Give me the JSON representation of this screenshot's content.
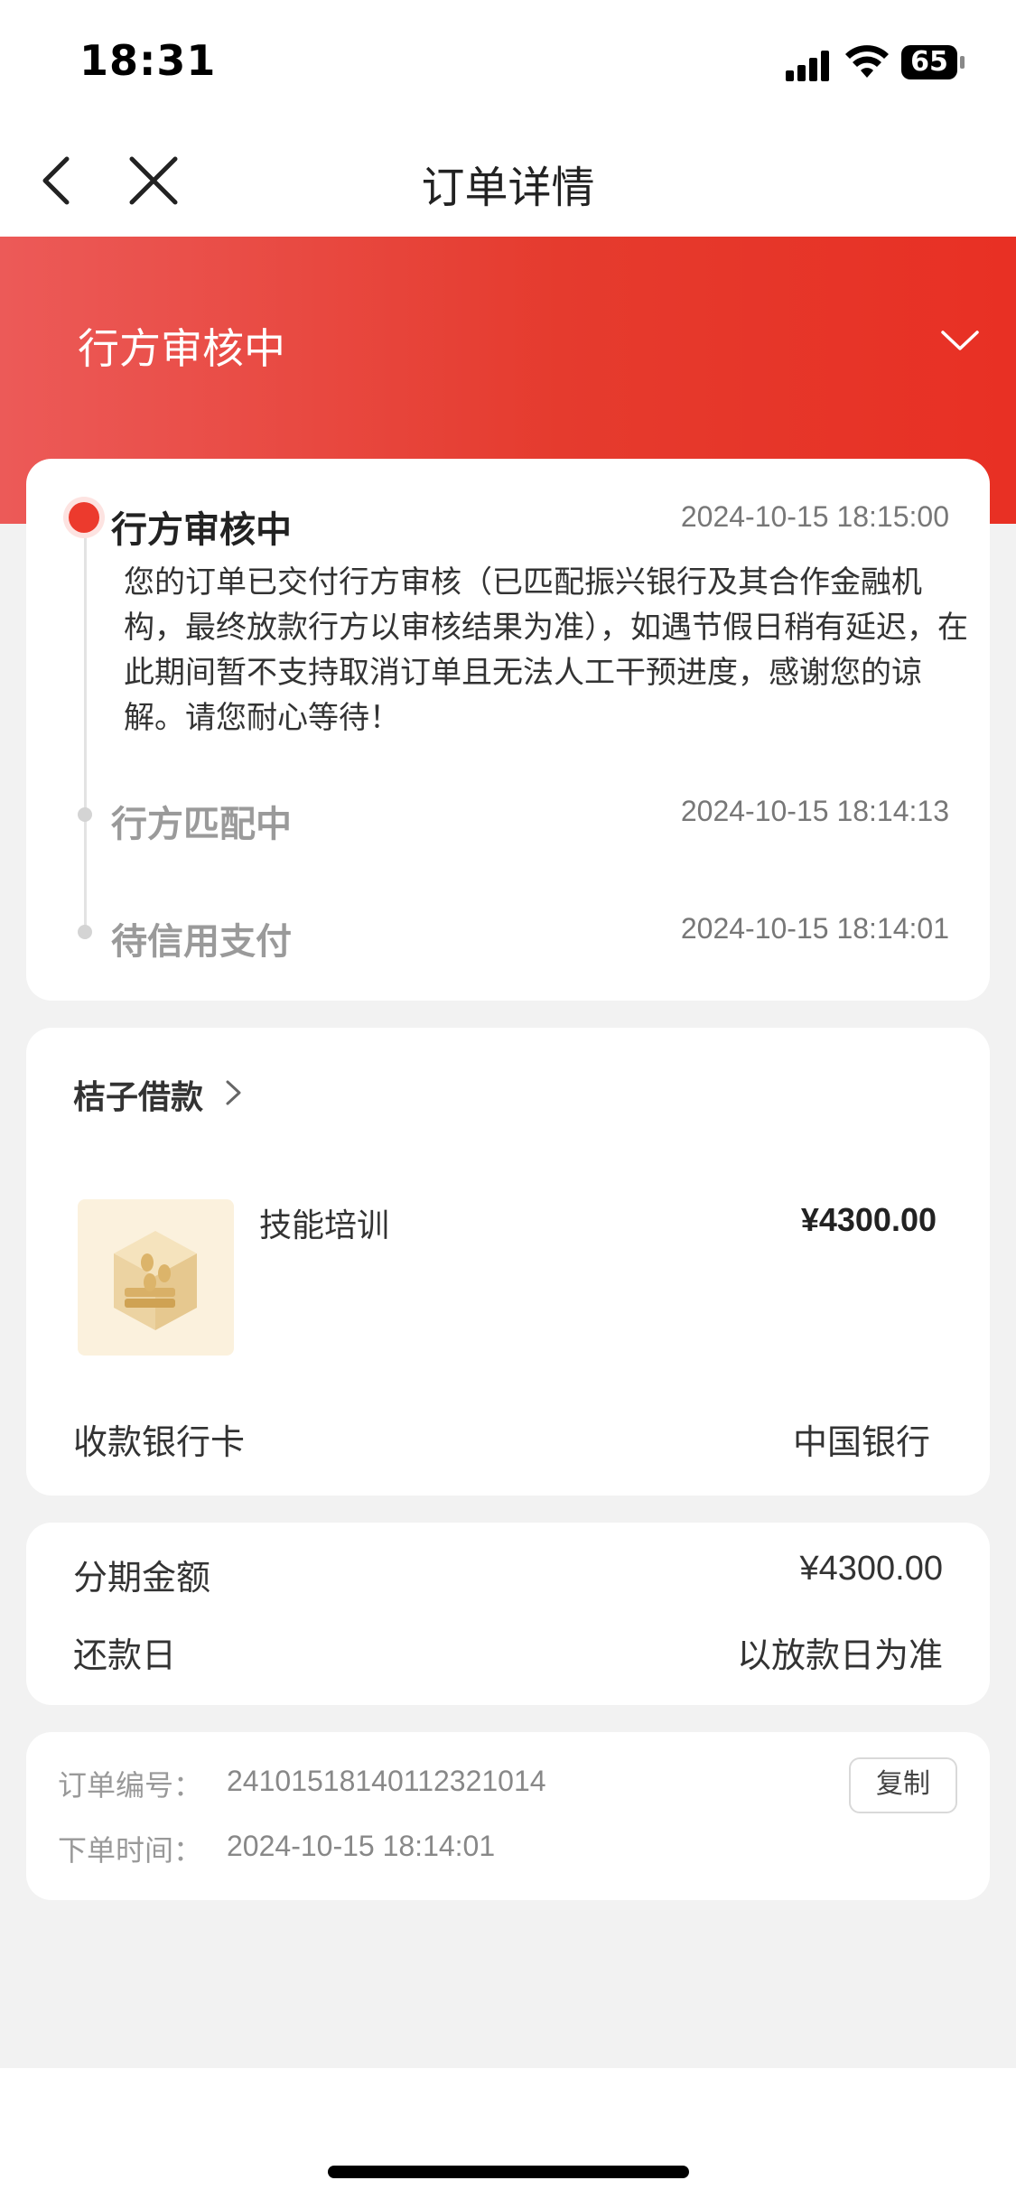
{
  "status_bar": {
    "time": "18:31",
    "battery": "65"
  },
  "nav": {
    "title": "订单详情"
  },
  "hero": {
    "status": "行方审核中"
  },
  "timeline": {
    "steps": [
      {
        "title": "行方审核中",
        "time": "2024-10-15 18:15:00",
        "active": true,
        "description": "您的订单已交付行方审核（已匹配振兴银行及其合作金融机构，最终放款行方以审核结果为准），如遇节假日稍有延迟，在此期间暂不支持取消订单且无法人工干预进度，感谢您的谅解。请您耐心等待！"
      },
      {
        "title": "行方匹配中",
        "time": "2024-10-15 18:14:13",
        "active": false
      },
      {
        "title": "待信用支付",
        "time": "2024-10-15 18:14:01",
        "active": false
      }
    ]
  },
  "merchant": {
    "name": "桔子借款",
    "product": {
      "name": "技能培训",
      "price": "¥4300.00"
    },
    "bank_label": "收款银行卡",
    "bank_value": "中国银行"
  },
  "installment": {
    "amount_label": "分期金额",
    "amount_value": "¥4300.00",
    "repay_label": "还款日",
    "repay_value": "以放款日为准"
  },
  "order": {
    "number_label": "订单编号：",
    "number_value": "24101518140112321014",
    "time_label": "下单时间：",
    "time_value": "2024-10-15 18:14:01",
    "copy_label": "复制"
  },
  "colors": {
    "accent": "#e53b2e",
    "hero_start": "#ec5a58",
    "hero_end": "#e83024"
  }
}
